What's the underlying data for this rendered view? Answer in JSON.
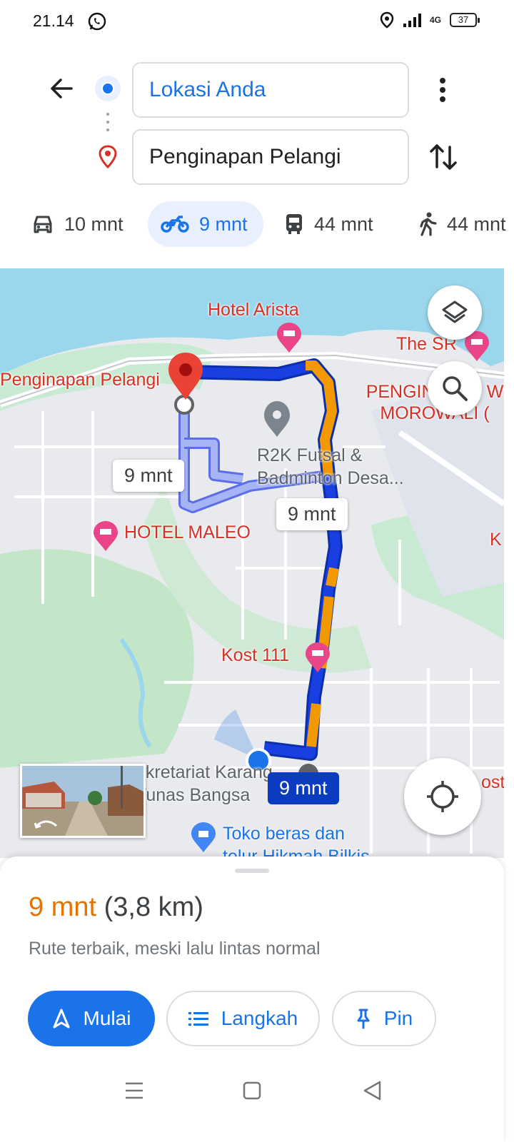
{
  "status_bar": {
    "time": "21.14",
    "network": "4G",
    "battery": "37"
  },
  "directions": {
    "origin": "Lokasi Anda",
    "destination": "Penginapan Pelangi"
  },
  "modes": [
    {
      "name": "car",
      "label": "10 mnt"
    },
    {
      "name": "motorcycle",
      "label": "9 mnt",
      "selected": true
    },
    {
      "name": "transit",
      "label": "44 mnt"
    },
    {
      "name": "walk",
      "label": "44 mnt"
    }
  ],
  "map": {
    "places": {
      "hotel_arista": "Hotel Arista",
      "the_sr": "The SR",
      "dest_label": "Penginapan Pelangi",
      "pengin_morowali": "PENGINAPAN W MOROWALI (",
      "r2k": "R2K Futsal & Badminton Desa...",
      "hotel_maleo": "HOTEL MALEO",
      "kost_111": "Kost 111",
      "sekretariat": "ekretariat Karang Tunas Bangsa",
      "toko": "Toko beras dan telur Hikmah Bilkis",
      "kost_edge": "ost",
      "k_edge": "K"
    },
    "route_chips": {
      "alt_left": "9 mnt",
      "alt_right": "9 mnt",
      "main": "9 mnt"
    },
    "colors": {
      "route_main": "#1a3fe0",
      "traffic_slow": "#f29900",
      "route_alt": "#a6b4f5"
    }
  },
  "sheet": {
    "duration": "9 mnt",
    "distance": "(3,8 km)",
    "subtitle": "Rute terbaik, meski lalu lintas normal",
    "buttons": {
      "start": "Mulai",
      "steps": "Langkah",
      "pin": "Pin"
    }
  }
}
